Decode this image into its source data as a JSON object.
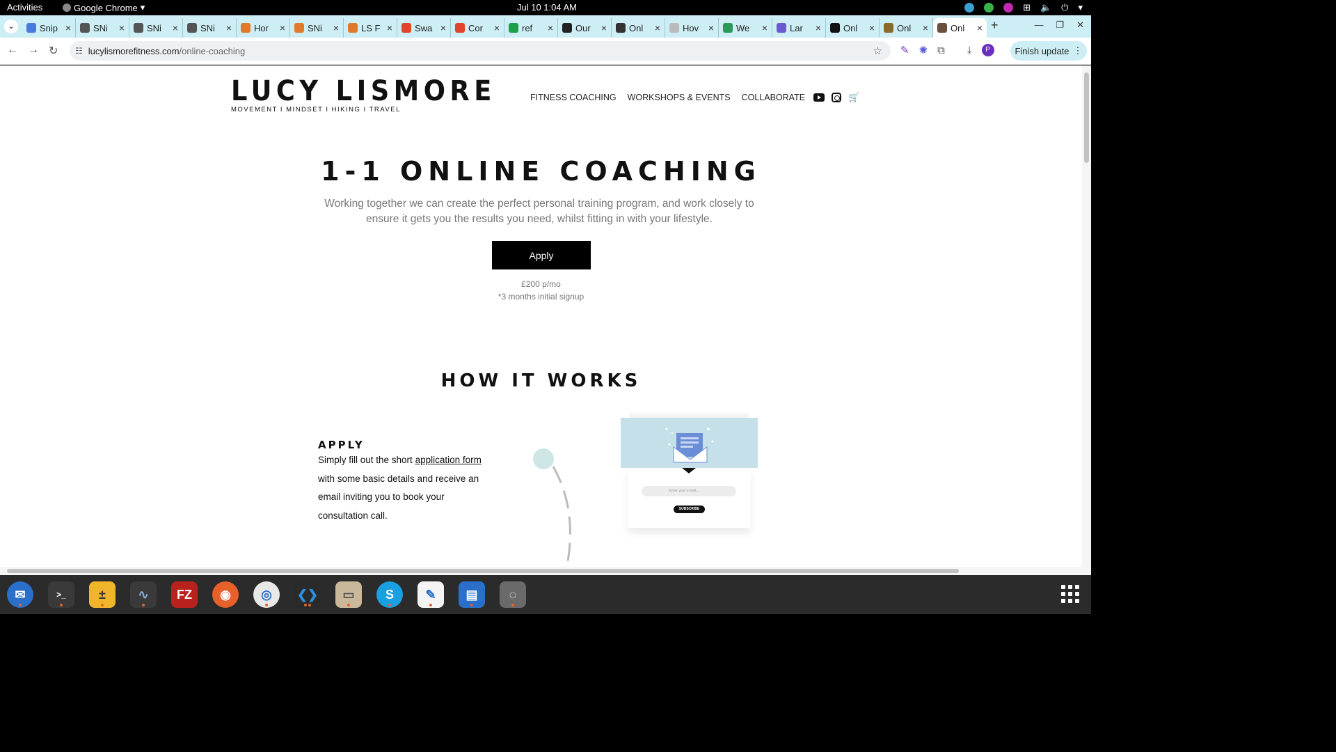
{
  "system": {
    "activities": "Activities",
    "app_name": "Google Chrome",
    "clock": "Jul 10  1:04 AM"
  },
  "tabs": [
    {
      "title": "Snip",
      "color": "#4a7ae0"
    },
    {
      "title": "SNi",
      "color": "#555555"
    },
    {
      "title": "SNi",
      "color": "#555555"
    },
    {
      "title": "SNi",
      "color": "#555555"
    },
    {
      "title": "Hor",
      "color": "#e07a2a"
    },
    {
      "title": "SNi",
      "color": "#e07a2a"
    },
    {
      "title": "LS F",
      "color": "#e07a2a"
    },
    {
      "title": "Swa",
      "color": "#e2432a"
    },
    {
      "title": "Cor",
      "color": "#e2432a"
    },
    {
      "title": "ref",
      "color": "#1e9e4a"
    },
    {
      "title": "Our",
      "color": "#222222"
    },
    {
      "title": "Onl",
      "color": "#333333"
    },
    {
      "title": "Hov",
      "color": "#bbbbbb"
    },
    {
      "title": "We",
      "color": "#2a9a5a"
    },
    {
      "title": "Lar",
      "color": "#6a5ad0"
    },
    {
      "title": "Onl",
      "color": "#111111"
    },
    {
      "title": "Onl",
      "color": "#8a6a2a"
    },
    {
      "title": "Onl",
      "color": "#6a5040"
    }
  ],
  "toolbar": {
    "url_host": "lucylismorefitness.com",
    "url_path": "/online-coaching",
    "finish_update": "Finish update",
    "profile_initial": "P"
  },
  "site": {
    "logo_name": "LUCY LISMORE",
    "logo_tagline": "MOVEMENT I MINDSET I HIKING I TRAVEL",
    "nav": [
      "FITNESS COACHING",
      "WORKSHOPS & EVENTS",
      "COLLABORATE"
    ]
  },
  "hero": {
    "title": "1-1 ONLINE COACHING",
    "text": "Working together we can create the perfect personal training program, and work closely to ensure it gets you the results you need, whilst fitting in with your lifestyle.",
    "apply_label": "Apply",
    "price": "£200 p/mo",
    "signup_note": "*3 months initial signup"
  },
  "how_it_works": {
    "title": "HOW IT WORKS",
    "step1": {
      "title": "APPLY",
      "text_before": "Simply fill out the short ",
      "link": "application form",
      "text_after": " with some basic details and receive an email inviting you to book your consultation call."
    },
    "card": {
      "email_placeholder": "Enter your e-mail...",
      "subscribe_label": "SUBSCRIBE"
    }
  }
}
